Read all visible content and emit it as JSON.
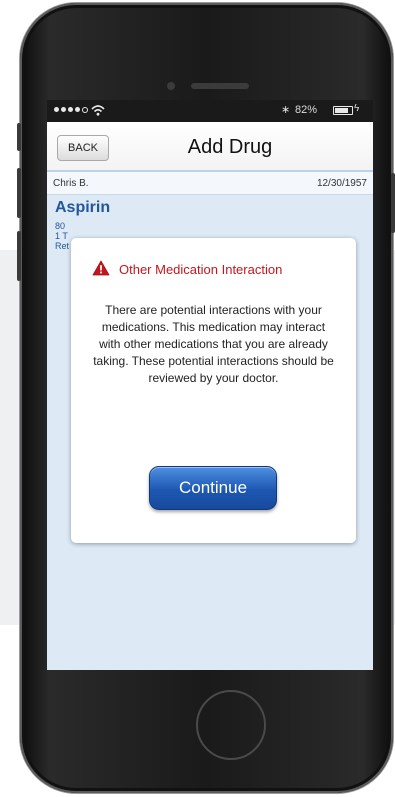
{
  "status_bar": {
    "battery_percent": "82%",
    "battery_level": 0.82
  },
  "nav": {
    "back_label": "BACK",
    "title": "Add Drug"
  },
  "patient": {
    "name": "Chris B.",
    "dob": "12/30/1957"
  },
  "drug": {
    "name": "Aspirin",
    "details": [
      "80",
      "1 T",
      "Ret"
    ]
  },
  "dialog": {
    "title": "Other Medication Interaction",
    "message": "There are potential interactions with your medications. This medication may interact with other medications that you are already taking. These potential interactions should be reviewed by your doctor.",
    "button_label": "Continue"
  },
  "colors": {
    "accent_blue": "#23569b",
    "warning_red": "#c4161c",
    "content_bg": "#ddeaf6"
  }
}
